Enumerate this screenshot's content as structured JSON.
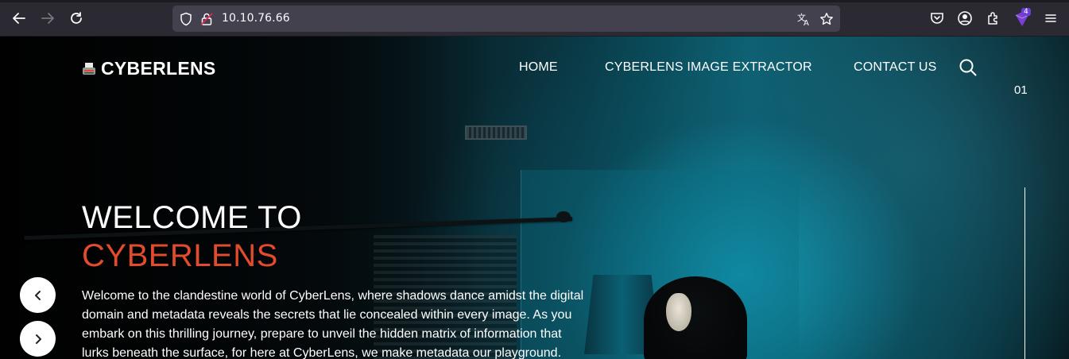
{
  "browser": {
    "url": "10.10.76.66",
    "extensions_badge": "4",
    "icons": [
      "back-icon",
      "forward-icon",
      "reload-icon",
      "shield-icon",
      "lock-warning-icon",
      "translate-icon",
      "star-icon",
      "pocket-icon",
      "account-icon",
      "extensions-icon",
      "menu-icon"
    ]
  },
  "site": {
    "logo_text": "CYBERLENS",
    "nav": {
      "home": "HOME",
      "extractor": "CYBERLENS IMAGE EXTRACTOR",
      "contact": "CONTACT US"
    },
    "slide_number": "01"
  },
  "hero": {
    "title_line1": "WELCOME TO",
    "title_line2": "CYBERLENS",
    "description": "Welcome to the clandestine world of CyberLens, where shadows dance amidst the digital domain and metadata reveals the secrets that lie concealed within every image. As you embark on this thrilling journey, prepare to unveil the hidden matrix of information that lurks beneath the surface, for here at CyberLens, we make metadata our playground."
  },
  "colors": {
    "accent": "#e24b2b",
    "browser_bg": "#2b2a33",
    "urlbar_bg": "#42414d"
  }
}
